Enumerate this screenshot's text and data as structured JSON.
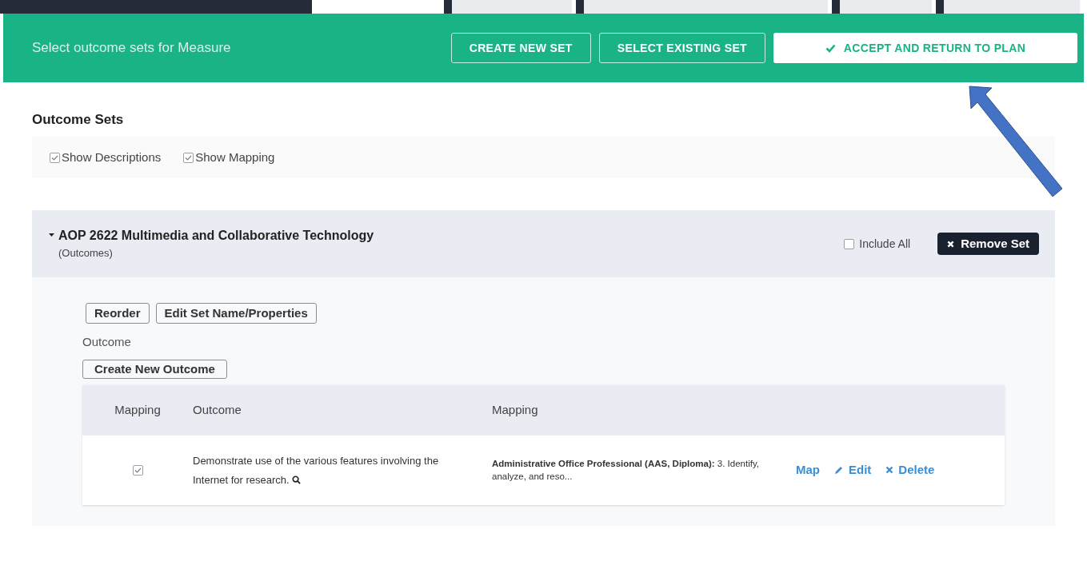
{
  "toolbar": {
    "title": "Select outcome sets for Measure",
    "buttons": [
      {
        "label": "CREATE NEW SET",
        "kind": "outline"
      },
      {
        "label": "SELECT EXISTING SET",
        "kind": "outline"
      },
      {
        "label": "ACCEPT AND RETURN TO PLAN",
        "kind": "primary"
      }
    ]
  },
  "heading": "Outcome Sets",
  "filters": [
    {
      "label": "Show Descriptions",
      "checked": true
    },
    {
      "label": "Show Mapping",
      "checked": true
    }
  ],
  "set": {
    "title": "AOP 2622 Multimedia and Collaborative Technology",
    "subtitle": "(Outcomes)",
    "expanded": true,
    "include_all": {
      "label": "Include All",
      "checked": false
    },
    "remove_label": "Remove Set",
    "actions": [
      "Reorder",
      "Edit Set Name/Properties"
    ],
    "section_label": "Outcome",
    "create_label": "Create New Outcome",
    "table": {
      "columns": [
        "Mapping",
        "Outcome",
        "Mapping"
      ],
      "rows": [
        {
          "checked": true,
          "outcome": "Demonstrate use of the various features involving the Internet for research.",
          "mapping": "**Administrative Office Professional (AAS, Diploma):** 3. Identify, analyze, and reso...",
          "actions": [
            {
              "label": "Map",
              "kind": "map"
            },
            {
              "label": "Edit",
              "kind": "edit"
            },
            {
              "label": "Delete",
              "kind": "delete"
            }
          ]
        }
      ]
    }
  }
}
